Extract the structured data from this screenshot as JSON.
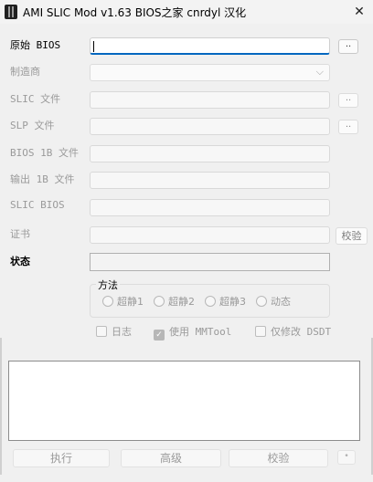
{
  "window": {
    "title": "AMI SLIC Mod v1.63  BIOS之家 cnrdyl 汉化",
    "close_glyph": "✕"
  },
  "labels": {
    "orig_bios": "原始 BIOS",
    "manufacturer": "制造商",
    "slic_file": "SLIC 文件",
    "slp_file": "SLP 文件",
    "bios_1b_file": "BIOS 1B 文件",
    "output_1b_file": "输出 1B 文件",
    "slic_bios": "SLIC BIOS",
    "certificate": "证书",
    "status": "状态"
  },
  "browse_label": "..",
  "verify_small": "校验",
  "method": {
    "title": "方法",
    "options": [
      "超静1",
      "超静2",
      "超静3",
      "动态"
    ]
  },
  "options": {
    "log": "日志",
    "use_mmtool": "使用 MMTool",
    "modify_dsdt_only": "仅修改 DSDT"
  },
  "buttons": {
    "execute": "执行",
    "advanced": "高级",
    "verify": "校验",
    "extra": "•"
  },
  "icons": {
    "app": "app-icon",
    "close": "close-icon",
    "chevron": "chevron-down-icon"
  }
}
